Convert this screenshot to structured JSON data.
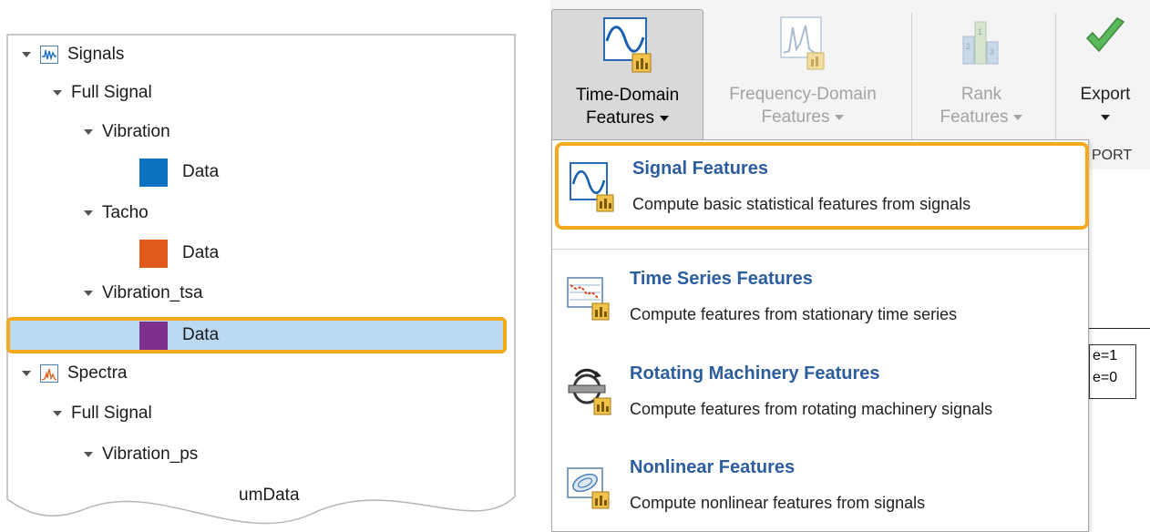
{
  "tree": {
    "items": [
      {
        "label": "Signals",
        "icon": "signals-icon"
      },
      {
        "label": "Full Signal"
      },
      {
        "label": "Vibration"
      },
      {
        "label": "Data",
        "color": "#0a72c0"
      },
      {
        "label": "Tacho"
      },
      {
        "label": "Data",
        "color": "#e05a1c"
      },
      {
        "label": "Vibration_tsa"
      },
      {
        "label": "Data",
        "color": "#7d2f8e",
        "selected": true
      },
      {
        "label": "Spectra",
        "icon": "spectra-icon"
      },
      {
        "label": "Full Signal"
      },
      {
        "label": "Vibration_ps"
      },
      {
        "label": "umData"
      }
    ]
  },
  "toolstrip": {
    "time_domain": {
      "line1": "Time-Domain",
      "line2": "Features"
    },
    "frequency_domain": {
      "line1": "Frequency-Domain",
      "line2": "Features"
    },
    "rank": {
      "line1": "Rank",
      "line2": "Features"
    },
    "export": {
      "line1": "Export"
    },
    "section_label": "PORT"
  },
  "menu": {
    "items": [
      {
        "title": "Signal Features",
        "description": "Compute basic statistical features from signals",
        "icon": "signal-features-icon"
      },
      {
        "title": "Time Series Features",
        "description": "Compute features from stationary time series",
        "icon": "time-series-features-icon"
      },
      {
        "title": "Rotating Machinery Features",
        "description": "Compute features from rotating machinery signals",
        "icon": "rotating-machinery-icon"
      },
      {
        "title": "Nonlinear Features",
        "description": "Compute nonlinear features from signals",
        "icon": "nonlinear-features-icon"
      }
    ]
  },
  "background": {
    "legend_line1": "e=1",
    "legend_line2": "e=0"
  },
  "colors": {
    "highlight": "#f5a91f",
    "selection": "#bcd9f2",
    "menu_title": "#2c5d9e"
  }
}
